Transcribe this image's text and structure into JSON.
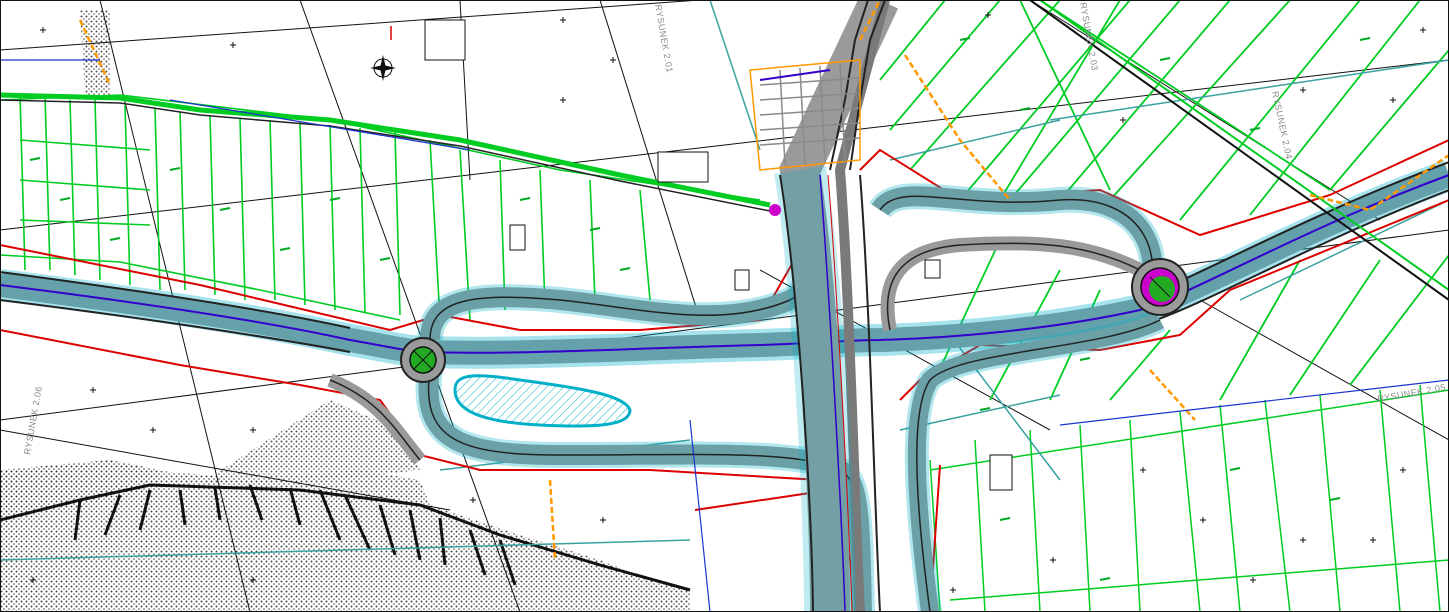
{
  "sheet_refs": [
    {
      "key": "r201",
      "label": "RYSUNEK 2.01"
    },
    {
      "key": "r203",
      "label": "RYSUNEK 2.03"
    },
    {
      "key": "r204",
      "label": "RYSUNEK 2.04"
    },
    {
      "key": "r205",
      "label": "RYSUNEK 2.05"
    },
    {
      "key": "r206",
      "label": "RYSUNEK 2.06"
    }
  ],
  "colors": {
    "background": "#ffffff",
    "parcel_green": "#00cc22",
    "parcel_bright": "#33ff33",
    "boundary_red": "#dd0000",
    "road_surface": "#9a9a9a",
    "road_edge": "#222222",
    "road_center": "#3300cc",
    "curb_cyan": "#00b0c8",
    "teal_line": "#3aa0a0",
    "orange_line": "#ff9900",
    "roundabout_green": "#22aa22",
    "roundabout_magenta": "#cc00cc",
    "hatch": "#444444",
    "blue_line": "#1a33cc"
  },
  "icons": [
    "north-arrow-icon"
  ]
}
